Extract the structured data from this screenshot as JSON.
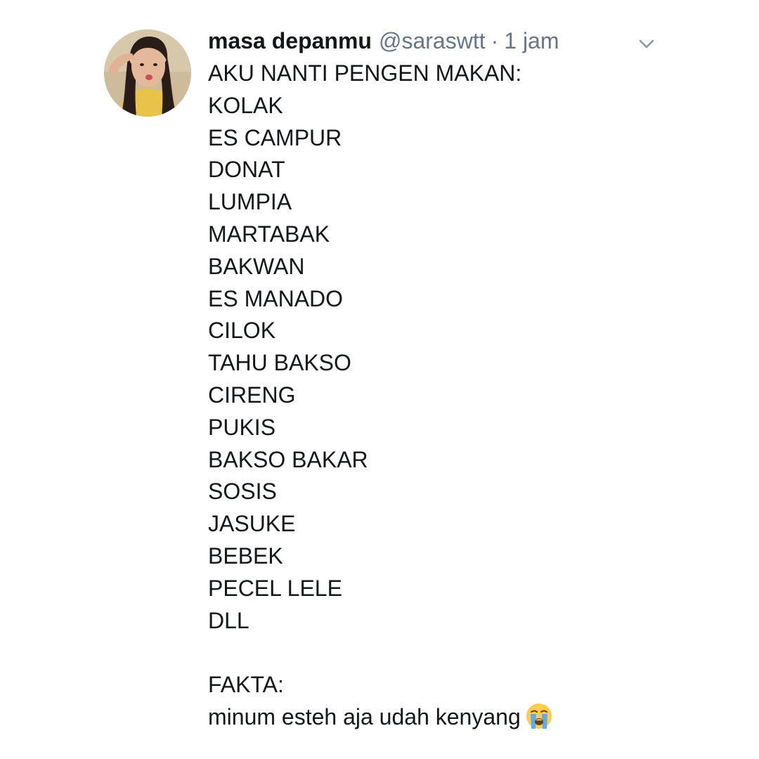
{
  "tweet": {
    "display_name": "masa depanmu",
    "handle": "@saraswtt",
    "separator": "·",
    "timestamp": "1 jam",
    "menu_icon": "chevron-down-icon",
    "lines": [
      "AKU NANTI PENGEN MAKAN:",
      "KOLAK",
      "ES CAMPUR",
      "DONAT",
      "LUMPIA",
      "MARTABAK",
      "BAKWAN",
      "ES MANADO",
      "CILOK",
      "TAHU BAKSO",
      "CIRENG",
      "PUKIS",
      "BAKSO BAKAR",
      "SOSIS",
      "JASUKE",
      "BEBEK",
      "PECEL LELE",
      "DLL",
      "",
      "FAKTA:"
    ],
    "last_line": "minum esteh aja udah kenyang",
    "last_line_emoji": "loudly-crying-face-emoji"
  },
  "colors": {
    "text": "#14171a",
    "secondary": "#657786",
    "background": "#ffffff"
  }
}
